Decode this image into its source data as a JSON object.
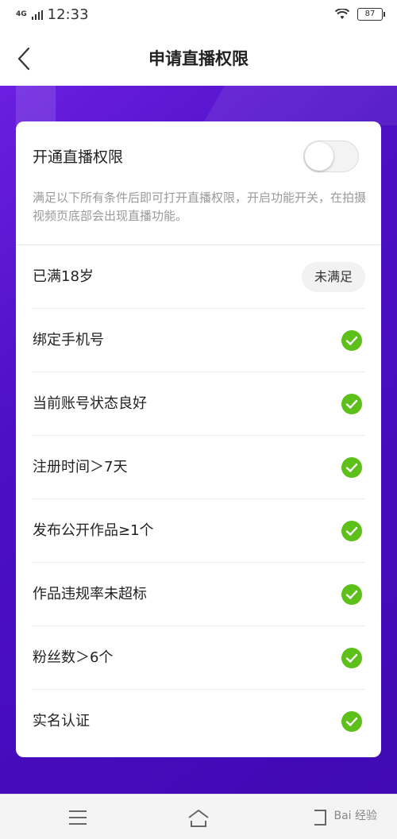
{
  "status_bar": {
    "network": "4G",
    "time": "12:33",
    "battery": "87"
  },
  "header": {
    "title": "申请直播权限"
  },
  "card": {
    "toggle_label": "开通直播权限",
    "toggle_on": false,
    "description": "满足以下所有条件后即可打开直播权限，开启功能开关，在拍摄视频页底部会出现直播功能。",
    "conditions": [
      {
        "label": "已满18岁",
        "status": "未满足"
      },
      {
        "label": "绑定手机号",
        "status": "check-icon"
      },
      {
        "label": "当前账号状态良好",
        "status": "check-icon"
      },
      {
        "label": "注册时间＞7天",
        "status": "check-icon"
      },
      {
        "label": "发布公开作品≥1个",
        "status": "check-icon"
      },
      {
        "label": "作品违规率未超标",
        "status": "check-icon"
      },
      {
        "label": "粉丝数＞6个",
        "status": "check-icon"
      },
      {
        "label": "实名认证",
        "status": "check-icon"
      }
    ]
  },
  "bottom_nav": {
    "items": [
      "menu-icon",
      "home-icon",
      "back-icon"
    ],
    "watermark": "Bai 经验"
  },
  "colors": {
    "purple_bg": "#4d0fc4",
    "check_green": "#5cbf1a"
  }
}
